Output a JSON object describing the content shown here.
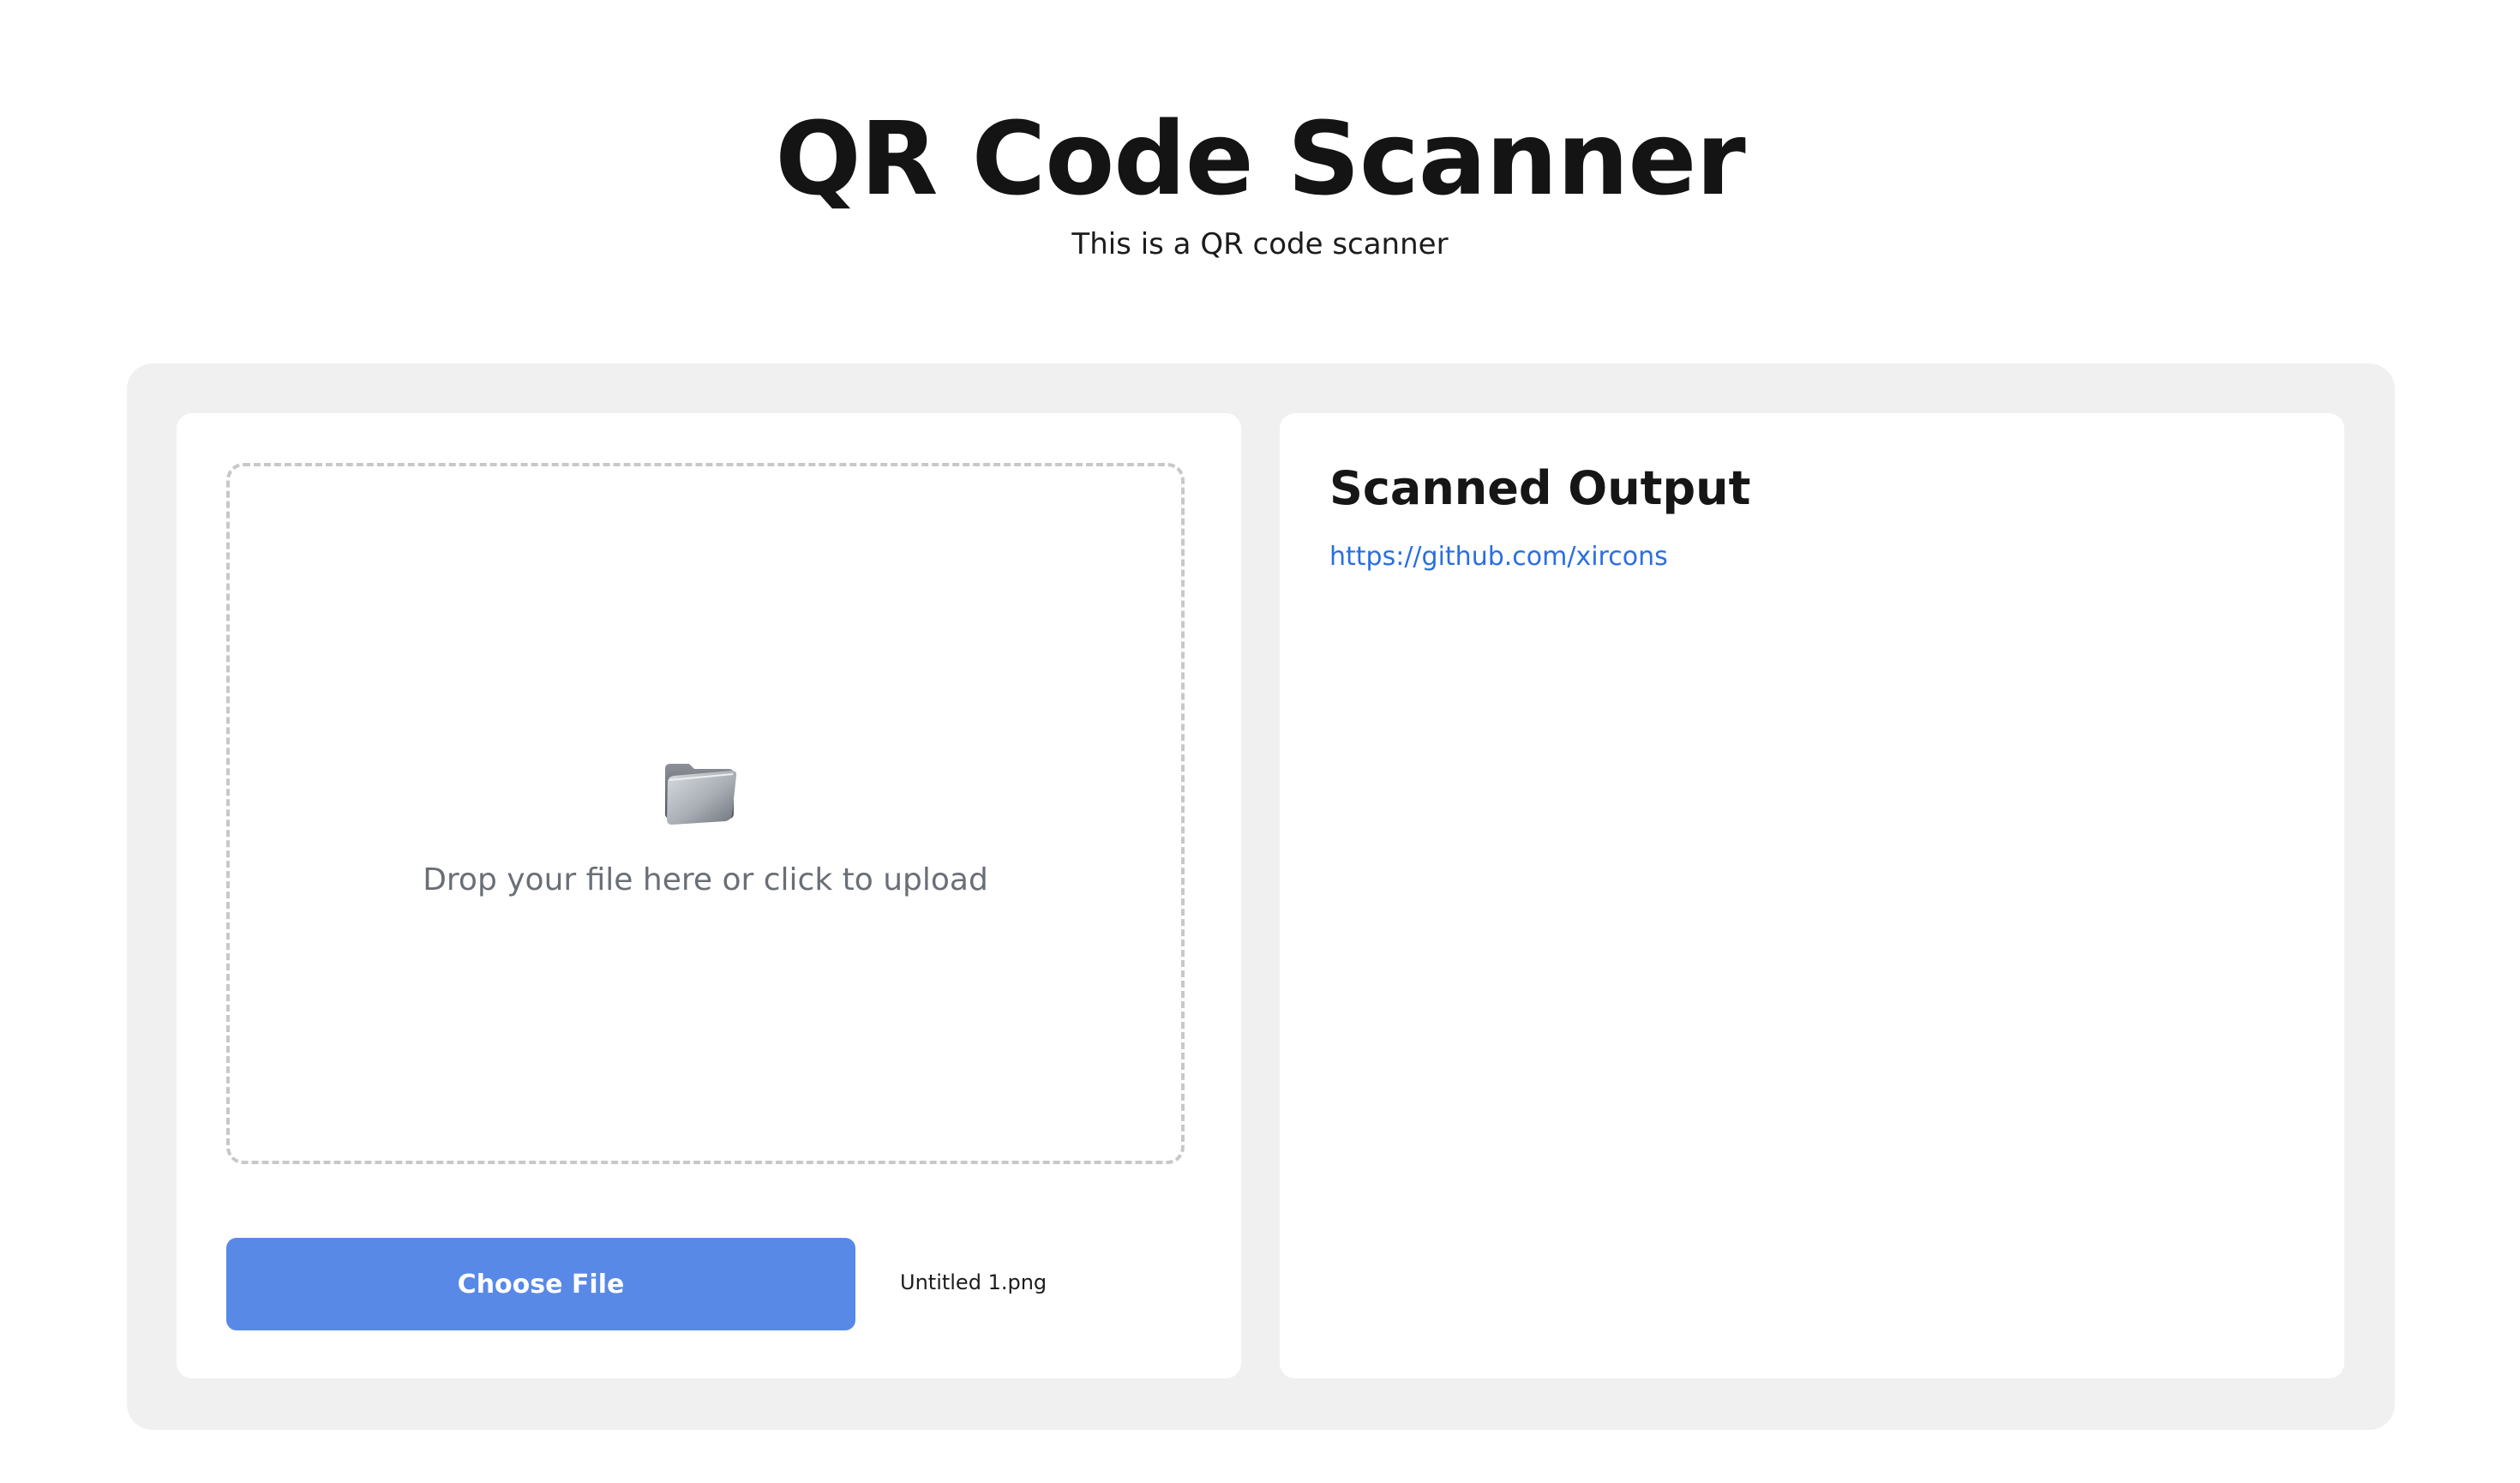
{
  "header": {
    "title": "QR Code Scanner",
    "subtitle": "This is a QR code scanner"
  },
  "upload": {
    "icon": "folder-icon",
    "dropzone_text": "Drop your file here or click to upload",
    "button_label": "Choose File",
    "file_name": "Untitled 1.png"
  },
  "output": {
    "title": "Scanned Output",
    "result_link": "https://github.com/xircons"
  },
  "colors": {
    "accent": "#5889e6",
    "link": "#2a6fe0",
    "shell_background": "#f0f0f0",
    "card_background": "#ffffff",
    "dropzone_border": "#c8c8c8"
  }
}
